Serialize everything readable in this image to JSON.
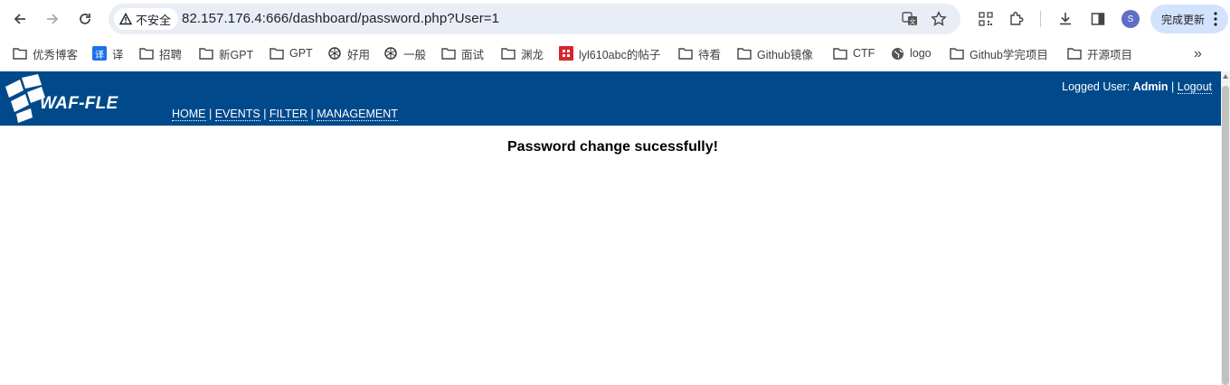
{
  "browser": {
    "url": "82.157.176.4:666/dashboard/password.php?User=1",
    "security_chip": "不安全",
    "update_button": "完成更新",
    "avatar_initial": "S"
  },
  "bookmarks": [
    {
      "label": "优秀博客",
      "icon": "folder-icon"
    },
    {
      "label": "译",
      "icon": "translate-icon"
    },
    {
      "label": "招聘",
      "icon": "folder-icon"
    },
    {
      "label": "新GPT",
      "icon": "folder-icon"
    },
    {
      "label": "GPT",
      "icon": "folder-icon"
    },
    {
      "label": "好用",
      "icon": "openai-icon"
    },
    {
      "label": "一般",
      "icon": "openai-icon"
    },
    {
      "label": "面试",
      "icon": "folder-icon"
    },
    {
      "label": "渊龙",
      "icon": "folder-icon"
    },
    {
      "label": "lyl610abc的帖子",
      "icon": "red-seal-icon"
    },
    {
      "label": "待看",
      "icon": "folder-icon"
    },
    {
      "label": "Github镜像",
      "icon": "folder-icon"
    },
    {
      "label": "CTF",
      "icon": "folder-icon"
    },
    {
      "label": "logo",
      "icon": "globe-icon"
    },
    {
      "label": "Github学完项目",
      "icon": "folder-icon"
    },
    {
      "label": "开源项目",
      "icon": "folder-icon"
    }
  ],
  "app": {
    "logo_text": "WAF-FLE",
    "menu": [
      "HOME",
      "EVENTS",
      "FILTER",
      "MANAGEMENT"
    ],
    "menu_separator": " | ",
    "user_prefix": "Logged User: ",
    "user_name": "Admin",
    "user_separator": " | ",
    "logout": "Logout",
    "message": "Password change sucessfully!"
  },
  "colors": {
    "header_bg": "#004a8c",
    "omnibox_bg": "#e9edf6",
    "update_button_bg": "#d3e3fd"
  }
}
